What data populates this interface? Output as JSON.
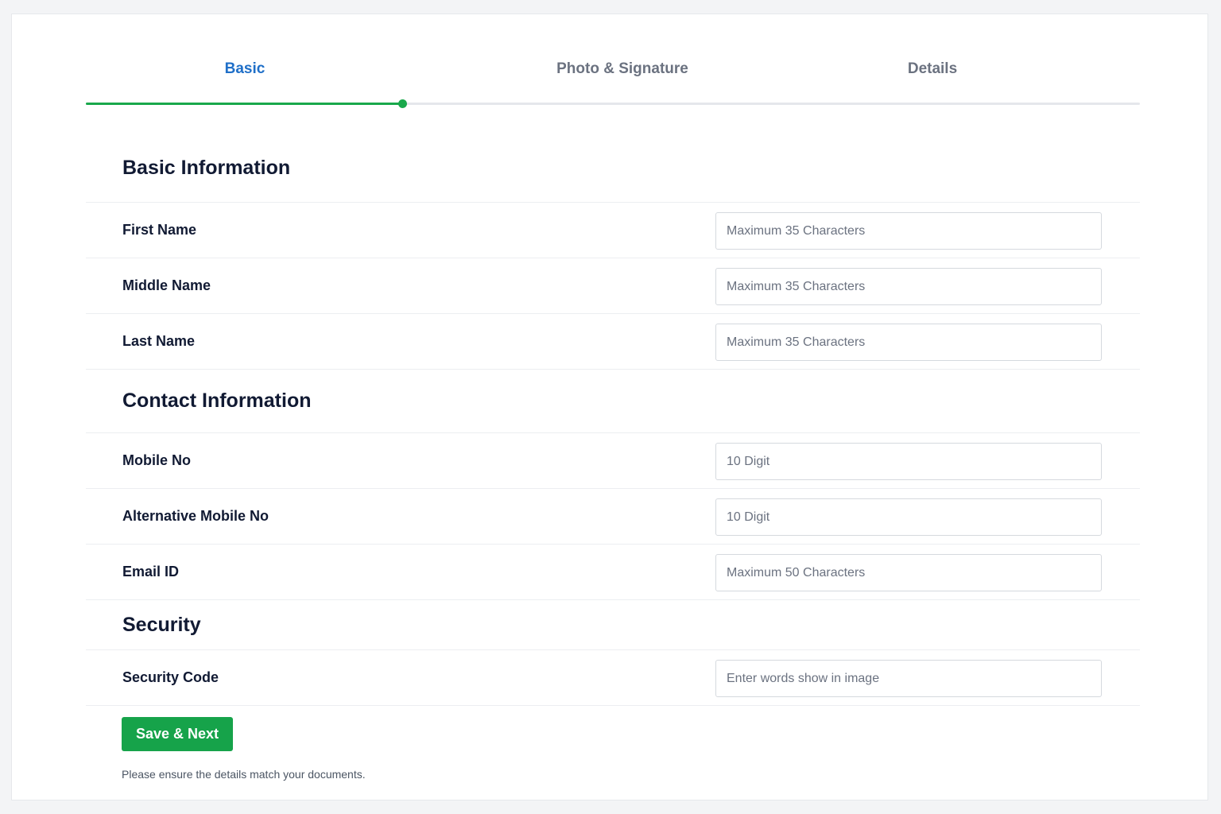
{
  "tabs": [
    {
      "label": "Basic",
      "active": true
    },
    {
      "label": "Photo & Signature",
      "active": false
    },
    {
      "label": "Details",
      "active": false
    }
  ],
  "progress": {
    "fraction": 0.3
  },
  "colors": {
    "accent": "#19a84b",
    "active_tab": "#1f6fc8",
    "heading": "#111a33",
    "button": "#16a34a"
  },
  "sections": {
    "basic": {
      "title": "Basic Information",
      "fields": [
        {
          "label": "First Name",
          "placeholder": "Maximum 35 Characters",
          "value": ""
        },
        {
          "label": "Middle Name",
          "placeholder": "Maximum 35 Characters",
          "value": ""
        },
        {
          "label": "Last Name",
          "placeholder": "Maximum 35 Characters",
          "value": ""
        }
      ]
    },
    "contact": {
      "title": "Contact Information",
      "fields": [
        {
          "label": "Mobile No",
          "placeholder": "10 Digit",
          "value": ""
        },
        {
          "label": "Alternative Mobile No",
          "placeholder": "10 Digit",
          "value": ""
        },
        {
          "label": "Email ID",
          "placeholder": "Maximum 50 Characters",
          "value": ""
        }
      ]
    },
    "security": {
      "title": "Security",
      "fields": [
        {
          "label": "Security Code",
          "placeholder": "Enter words show in image",
          "value": ""
        }
      ]
    }
  },
  "actions": {
    "save_label": "Save & Next",
    "note": "Please ensure the details match your documents."
  }
}
